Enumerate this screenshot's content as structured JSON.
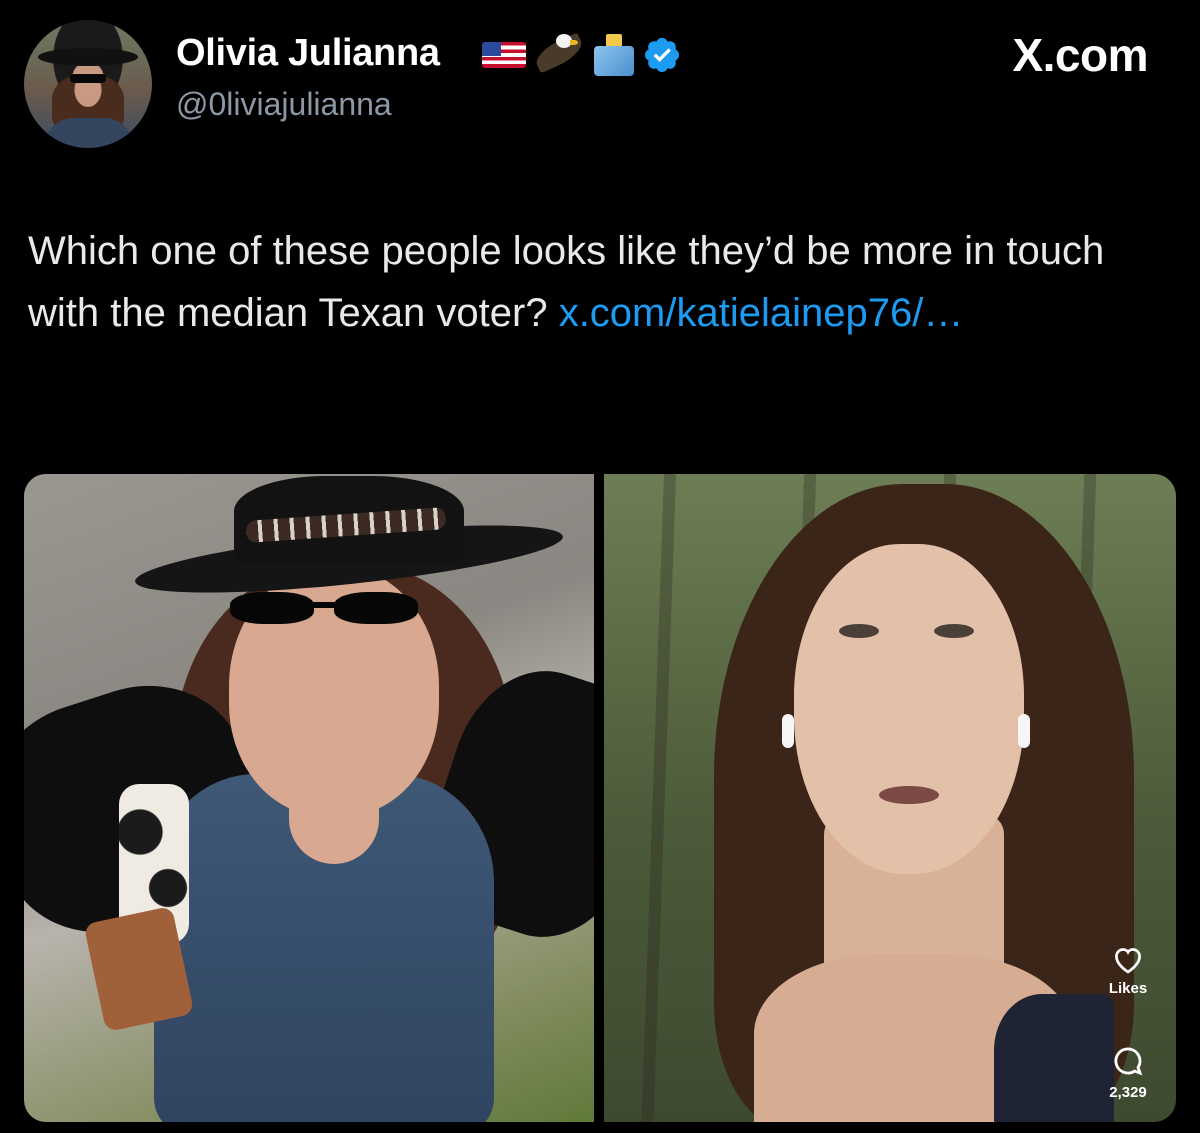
{
  "header": {
    "display_name": "Olivia Julianna",
    "name_emojis": [
      "flag-us-icon",
      "eagle-icon",
      "ballot-box-icon"
    ],
    "verified": true,
    "handle": "@0liviajulianna",
    "brand": "X.com"
  },
  "tweet": {
    "text": "Which one of these people looks like they’d be more in touch with the median Texan voter? ",
    "link_text": "x.com/katielainep76/…"
  },
  "media": {
    "photos": [
      "left-photo",
      "right-photo"
    ],
    "overlay": {
      "likes_label": "Likes",
      "comments_count": "2,329"
    }
  },
  "colors": {
    "background": "#000000",
    "text": "#e7e9ea",
    "secondary_text": "#8b98a5",
    "link": "#1d9bf0",
    "verified": "#1d9bf0"
  }
}
